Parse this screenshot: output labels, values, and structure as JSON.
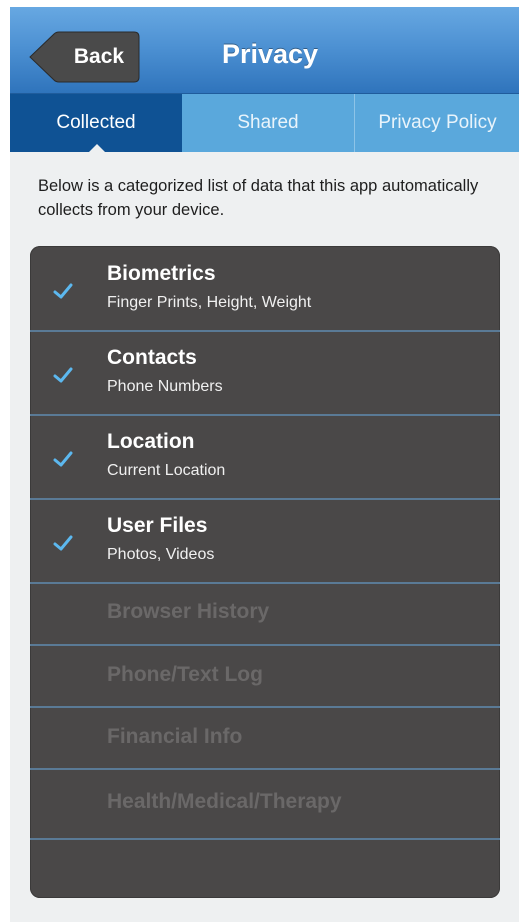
{
  "navbar": {
    "back_label": "Back",
    "title": "Privacy"
  },
  "tabs": [
    {
      "label": "Collected",
      "selected": true
    },
    {
      "label": "Shared",
      "selected": false
    },
    {
      "label": "Privacy Policy",
      "selected": false
    }
  ],
  "intro_text": "Below is a categorized list of data that this app automatically collects from your device.",
  "categories": [
    {
      "title": "Biometrics",
      "subtitle": "Finger Prints, Height, Weight",
      "collected": true
    },
    {
      "title": "Contacts",
      "subtitle": "Phone Numbers",
      "collected": true
    },
    {
      "title": "Location",
      "subtitle": "Current Location",
      "collected": true
    },
    {
      "title": "User Files",
      "subtitle": "Photos, Videos",
      "collected": true
    },
    {
      "title": "Browser History",
      "collected": false
    },
    {
      "title": "Phone/Text Log",
      "collected": false
    },
    {
      "title": "Financial Info",
      "collected": false
    },
    {
      "title": "Health/Medical/Therapy",
      "collected": false
    }
  ],
  "icons": {
    "check": "check-icon",
    "back": "back-arrow-button-shape"
  },
  "colors": {
    "navbar_blue": "#4c90d2",
    "tab_selected": "#0f5294",
    "tab_background": "#5aa8dc",
    "list_background": "#4a4848",
    "check_color": "#5cb8ef",
    "disabled_text": "#6a6868"
  }
}
